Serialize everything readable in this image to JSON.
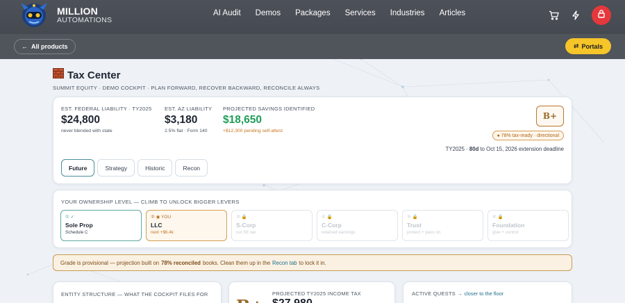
{
  "brand": {
    "line1": "MILLION",
    "line2": "AUTOMATIONS"
  },
  "nav": {
    "links": [
      "AI Audit",
      "Demos",
      "Packages",
      "Services",
      "Industries",
      "Articles"
    ]
  },
  "icons": {
    "cart": "cart-icon",
    "bolt": "bolt-icon",
    "lock": "lock-icon",
    "bricks": "brick-icon"
  },
  "subbar": {
    "back_label": "All products",
    "portals_label": "Portals"
  },
  "page": {
    "title": "Tax Center",
    "subtitle": "SUMMIT EQUITY · DEMO COCKPIT · PLAN FORWARD, RECOVER BACKWARD, RECONCILE ALWAYS"
  },
  "metrics": [
    {
      "label": "EST. FEDERAL LIABILITY · TY2025",
      "value": "$24,800",
      "note": "never blended with state"
    },
    {
      "label": "EST. AZ LIABILITY",
      "value": "$3,180",
      "note": "2.5% flat · Form 140"
    },
    {
      "label": "PROJECTED SAVINGS IDENTIFIED",
      "value": "$18,650",
      "note": "+$12,300 pending self-attest"
    }
  ],
  "grade": {
    "letter": "B+",
    "pill": "● 78% tax-ready · directional",
    "deadline_pre": "TY2025 · ",
    "deadline_days": "80d",
    "deadline_post": " to Oct 15, 2026 extension deadline"
  },
  "tabs": [
    "Future",
    "Strategy",
    "Historic",
    "Recon"
  ],
  "ownership": {
    "heading": "YOUR OWNERSHIP LEVEL — CLIMB TO UNLOCK BIGGER LEVERS",
    "levels": [
      {
        "status": "① ✓",
        "name": "Sole Prop",
        "desc": "Schedule C"
      },
      {
        "status": "② ◉ YOU",
        "name": "LLC",
        "desc": "next +$6.4k"
      },
      {
        "status": "③ 🔒",
        "name": "S-Corp",
        "desc": "cut SE tax"
      },
      {
        "status": "④ 🔒",
        "name": "C-Corp",
        "desc": "retained earnings"
      },
      {
        "status": "⑤ 🔒",
        "name": "Trust",
        "desc": "protect + pass on"
      },
      {
        "status": "⑥ 🔒",
        "name": "Foundation",
        "desc": "give + control"
      }
    ]
  },
  "banner": {
    "pre": "Grade is provisional — projection built on",
    "bold": "78% reconciled",
    "mid": "books. Clean them up in the",
    "link": "Recon tab",
    "post": "to lock it in."
  },
  "bottom": {
    "entity_label": "ENTITY STRUCTURE — WHAT THE COCKPIT FILES FOR",
    "grade_letter": "B+",
    "projected_label": "PROJECTED TY2025 INCOME TAX",
    "projected_value": "$27,980",
    "quests_label": "ACTIVE QUESTS →",
    "quests_link": "closer to the floor"
  },
  "colors": {
    "nav_bg": "#4b4f57",
    "accent_yellow": "#f6c52a",
    "accent_red": "#e5383b",
    "green": "#1f9d57",
    "teal": "#4a8e9a",
    "amber": "#b9772e"
  }
}
